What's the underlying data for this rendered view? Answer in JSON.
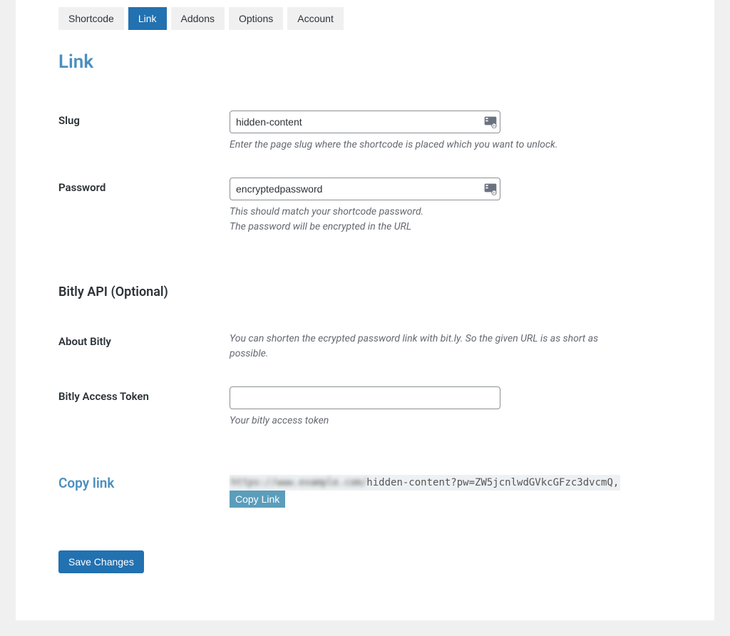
{
  "tabs": {
    "shortcode": "Shortcode",
    "link": "Link",
    "addons": "Addons",
    "options": "Options",
    "account": "Account"
  },
  "section_title": "Link",
  "slug": {
    "label": "Slug",
    "value": "hidden-content",
    "hint": "Enter the page slug where the shortcode is placed which you want to unlock."
  },
  "password": {
    "label": "Password",
    "value": "encryptedpassword",
    "hint_line1": "This should match your shortcode password.",
    "hint_line2": "The password will be encrypted in the URL"
  },
  "bitly_section": "Bitly API (Optional)",
  "about_bitly": {
    "label": "About Bitly",
    "text": "You can shorten the ecrypted password link with bit.ly. So the given URL is as short as possible."
  },
  "bitly_token": {
    "label": "Bitly Access Token",
    "value": "",
    "hint": "Your bitly access token"
  },
  "copy_link": {
    "label": "Copy link",
    "url_hidden": "https://www.example.com/",
    "url_visible": "hidden-content?pw=ZW5jcnlwdGVkcGFzc3dvcmQ,",
    "button": "Copy Link"
  },
  "save_button": "Save Changes"
}
